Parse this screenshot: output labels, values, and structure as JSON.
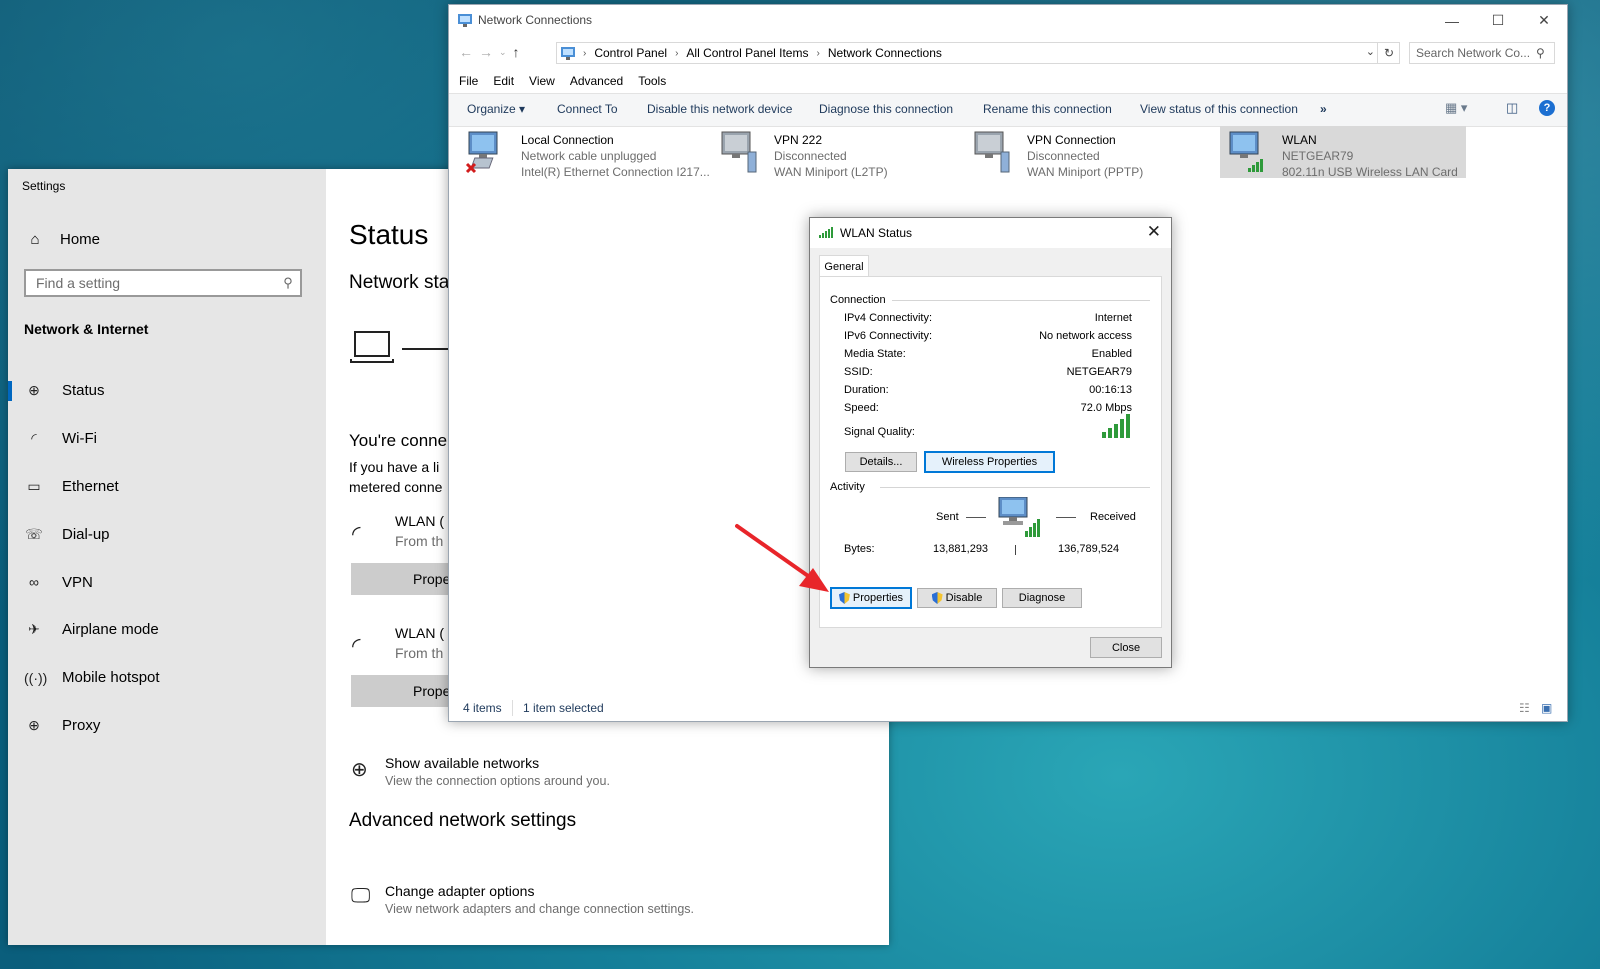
{
  "settings": {
    "app_title": "Settings",
    "home_label": "Home",
    "search_placeholder": "Find a setting",
    "section_title": "Network & Internet",
    "nav_items": [
      {
        "label": "Status",
        "icon": "globe-icon"
      },
      {
        "label": "Wi-Fi",
        "icon": "wifi-icon"
      },
      {
        "label": "Ethernet",
        "icon": "ethernet-icon"
      },
      {
        "label": "Dial-up",
        "icon": "dialup-icon"
      },
      {
        "label": "VPN",
        "icon": "vpn-icon"
      },
      {
        "label": "Airplane mode",
        "icon": "airplane-icon"
      },
      {
        "label": "Mobile hotspot",
        "icon": "hotspot-icon"
      },
      {
        "label": "Proxy",
        "icon": "proxy-icon"
      }
    ],
    "page_title": "Status",
    "network_status_heading": "Network sta",
    "connected_text": "You're conne",
    "metered_line1": "If you have a li",
    "metered_line2": "metered conne",
    "connections": [
      {
        "title": "WLAN (",
        "subtitle": "From th",
        "button": "Prope"
      },
      {
        "title": "WLAN (",
        "subtitle": "From th",
        "button": "Prope"
      }
    ],
    "show_networks_title": "Show available networks",
    "show_networks_desc": "View the connection options around you.",
    "advanced_heading": "Advanced network settings",
    "change_adapter_title": "Change adapter options",
    "change_adapter_desc": "View network adapters and change connection settings."
  },
  "explorer": {
    "title": "Network Connections",
    "breadcrumb": [
      "Control Panel",
      "All Control Panel Items",
      "Network Connections"
    ],
    "search_placeholder": "Search Network Co...",
    "menu": [
      "File",
      "Edit",
      "View",
      "Advanced",
      "Tools"
    ],
    "commands": {
      "organize": "Organize ▾",
      "connect_to": "Connect To",
      "disable": "Disable this network device",
      "diagnose": "Diagnose this connection",
      "rename": "Rename this connection",
      "view_status": "View status of this connection",
      "more": "»"
    },
    "connections": [
      {
        "name": "Local Connection",
        "status": "Network cable unplugged",
        "device": "Intel(R) Ethernet Connection I217...",
        "selected": false
      },
      {
        "name": "VPN 222",
        "status": "Disconnected",
        "device": "WAN Miniport (L2TP)",
        "selected": false
      },
      {
        "name": "VPN Connection",
        "status": "Disconnected",
        "device": "WAN Miniport (PPTP)",
        "selected": false
      },
      {
        "name": "WLAN",
        "status": "NETGEAR79",
        "device": "802.11n USB Wireless LAN Card",
        "selected": true
      }
    ],
    "status_items": "4 items",
    "status_selected": "1 item selected"
  },
  "dialog": {
    "title": "WLAN Status",
    "tab": "General",
    "connection_group": "Connection",
    "rows": [
      {
        "key": "IPv4 Connectivity:",
        "value": "Internet"
      },
      {
        "key": "IPv6 Connectivity:",
        "value": "No network access"
      },
      {
        "key": "Media State:",
        "value": "Enabled"
      },
      {
        "key": "SSID:",
        "value": "NETGEAR79"
      },
      {
        "key": "Duration:",
        "value": "00:16:13"
      },
      {
        "key": "Speed:",
        "value": "72.0 Mbps"
      }
    ],
    "signal_label": "Signal Quality:",
    "signal_bars": 5,
    "details_btn": "Details...",
    "wireless_props_btn": "Wireless Properties",
    "activity_group": "Activity",
    "sent_label": "Sent",
    "received_label": "Received",
    "bytes_label": "Bytes:",
    "bytes_sent": "13,881,293",
    "bytes_received": "136,789,524",
    "properties_btn": "Properties",
    "disable_btn": "Disable",
    "diagnose_btn": "Diagnose",
    "close_btn": "Close"
  },
  "colors": {
    "accent": "#0078d7",
    "annotation_arrow": "#e8252a",
    "selected_bg": "#d9d9d9"
  }
}
